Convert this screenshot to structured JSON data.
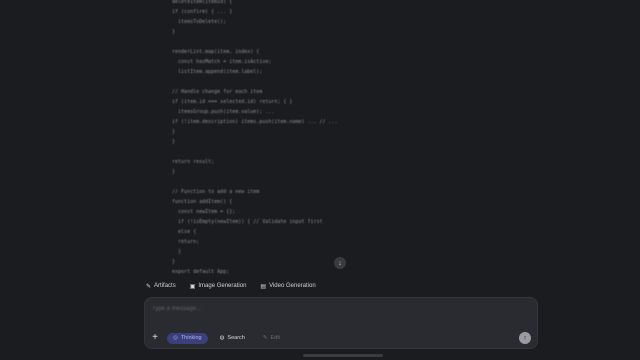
{
  "code_lines": [
    "  deleteItem(itemId) {",
    "  if (confirm) { ... }",
    "    itemsToDelete();",
    "  }",
    "",
    "  renderList.map(item, index) {",
    "    const hasMatch = item.isActive;",
    "    listItem.append(item.label);",
    "",
    "  // Handle change for each item",
    "  if (item.id === selected.id) return; { }",
    "    itemsGroup.push(item.value); ...",
    "  if (!item.description) items.push(item.name) ... // ...",
    "  }",
    "  }",
    "",
    "  return result;",
    "  }",
    "",
    "  // Function to add a new item",
    "  function addItem() {",
    "    const newItem = {};",
    "    if (!isEmpty(newItem)) { // Validate input first",
    "    else {",
    "    return;",
    "    }",
    "  }",
    "  export default App;"
  ],
  "tools": [
    {
      "label": "Artifacts",
      "icon": "artifacts-icon",
      "glyph": "✎"
    },
    {
      "label": "Image Generation",
      "icon": "image-icon",
      "glyph": "▣"
    },
    {
      "label": "Video Generation",
      "icon": "video-icon",
      "glyph": "▤"
    }
  ],
  "composer": {
    "placeholder": "Type a message...",
    "thinking_label": "Thinking",
    "search_label": "Search",
    "extra_label": "Edit"
  }
}
